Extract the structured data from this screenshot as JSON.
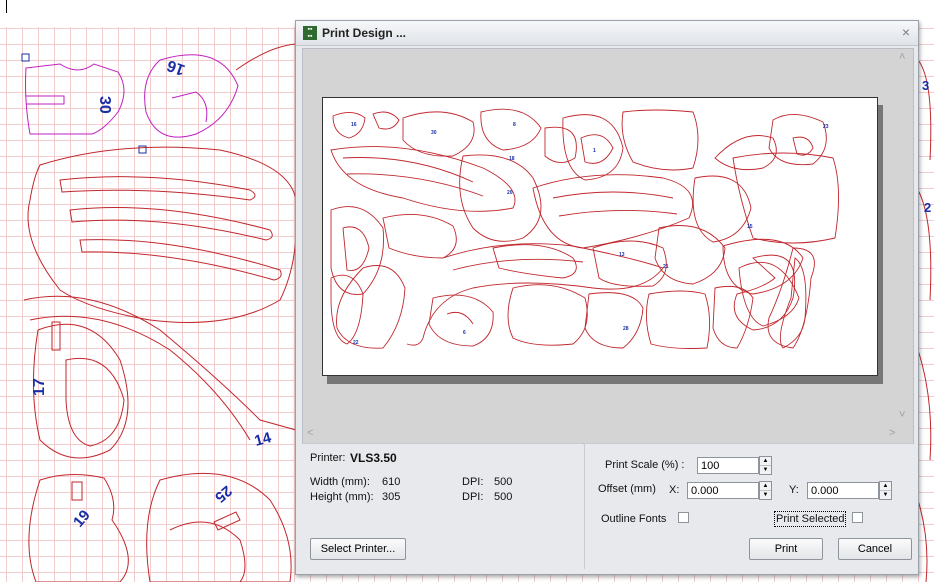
{
  "canvas": {
    "labels": {
      "piece_30": "30",
      "piece_16_rot": "16",
      "piece_17": "17",
      "piece_14": "14",
      "piece_19": "19",
      "piece_25": "25",
      "edge_right_top": "3",
      "edge_right_mid": "2"
    }
  },
  "dialog": {
    "title": "Print Design ...",
    "close_label": "×",
    "printer_label": "Printer:",
    "printer_name": "VLS3.50",
    "width_label": "Width (mm):",
    "width_value": "610",
    "height_label": "Height (mm):",
    "height_value": "305",
    "dpi_label": "DPI:",
    "dpi_x": "500",
    "dpi_y": "500",
    "select_printer_label": "Select Printer...",
    "print_scale_label": "Print Scale (%) :",
    "print_scale_value": "100",
    "offset_label": "Offset (mm)",
    "x_label": "X:",
    "x_value": "0.000",
    "y_label": "Y:",
    "y_value": "0.000",
    "outline_fonts_label": "Outline Fonts",
    "print_selected_label": "Print Selected",
    "print_label": "Print",
    "cancel_label": "Cancel"
  },
  "colors": {
    "outline": "#c0272d",
    "selected": "#c020c0",
    "label": "#1a2ea6"
  }
}
